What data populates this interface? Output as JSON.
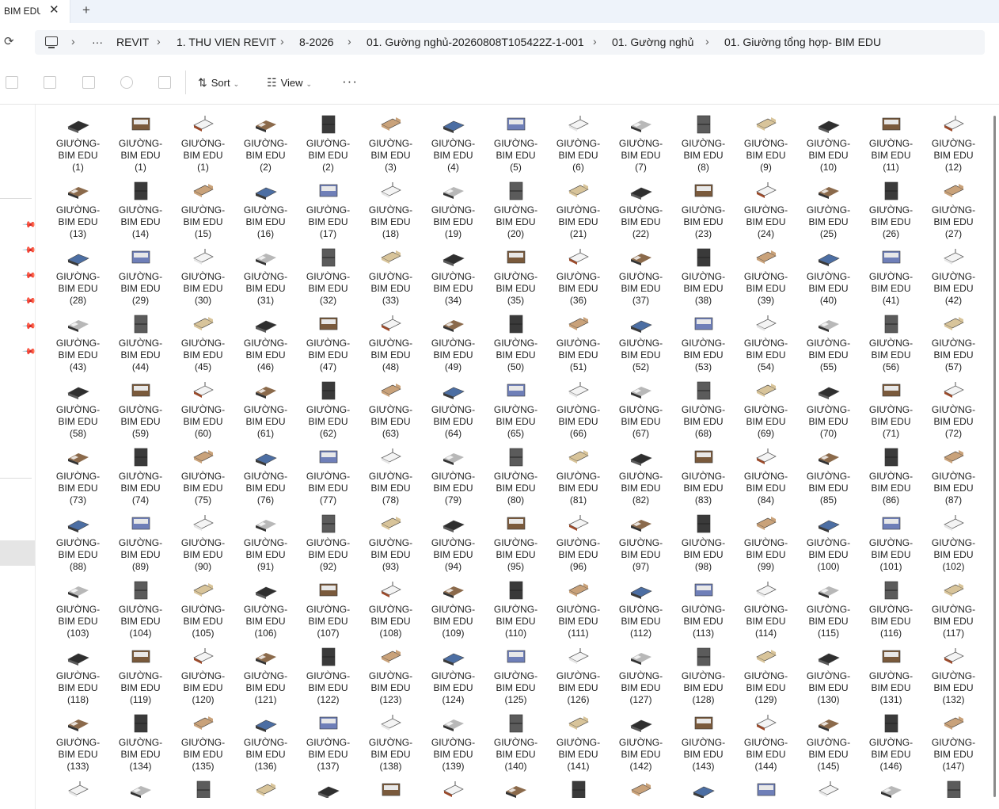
{
  "tab": {
    "title": "BIM EDU",
    "close_glyph": "✕",
    "new_glyph": "+"
  },
  "address": {
    "more_glyph": "···",
    "separator": "›",
    "crumbs": [
      "REVIT",
      "1. THU VIEN REVIT",
      "8-2026",
      "01. Gường nghủ-20260808T105422Z-1-001",
      "01. Gường nghủ",
      "01. Giường tổng hợp- BIM EDU"
    ]
  },
  "toolbar": {
    "sort_label": "Sort",
    "view_label": "View",
    "more_glyph": "···"
  },
  "icons": {
    "refresh": "refresh-icon",
    "pc": "this-pc-icon",
    "sort": "sort-icon",
    "view": "view-icon",
    "pin": "pin-icon"
  },
  "colors": {
    "accent": "#0067c0",
    "tabbar": "#eef3fa",
    "selection": "#e5e5e5"
  },
  "files": {
    "name_line1": "GIƯỜNG-",
    "name_line2": "BIM EDU",
    "numbers": [
      1,
      1,
      1,
      2,
      2,
      3,
      4,
      5,
      6,
      7,
      8,
      9,
      10,
      11,
      12,
      13,
      14,
      15,
      16,
      17,
      18,
      19,
      20,
      21,
      22,
      23,
      24,
      25,
      26,
      27,
      28,
      29,
      30,
      31,
      32,
      33,
      34,
      35,
      36,
      37,
      38,
      39,
      40,
      41,
      42,
      43,
      44,
      45,
      46,
      47,
      48,
      49,
      50,
      51,
      52,
      53,
      54,
      55,
      56,
      57,
      58,
      59,
      60,
      61,
      62,
      63,
      64,
      65,
      66,
      67,
      68,
      69,
      70,
      71,
      72,
      73,
      74,
      75,
      76,
      77,
      78,
      79,
      80,
      81,
      82,
      83,
      84,
      85,
      86,
      87,
      88,
      89,
      90,
      91,
      92,
      93,
      94,
      95,
      96,
      97,
      98,
      99,
      100,
      101,
      102,
      103,
      104,
      105,
      106,
      107,
      108,
      109,
      110,
      111,
      112,
      113,
      114,
      115,
      116,
      117,
      118,
      119,
      120,
      121,
      122,
      123,
      124,
      125,
      126,
      127,
      128,
      129,
      130,
      131,
      132,
      133,
      134,
      135,
      136,
      137,
      138,
      139,
      140,
      141,
      142,
      143,
      144,
      145,
      146,
      147
    ],
    "partial_row_count": 15
  }
}
